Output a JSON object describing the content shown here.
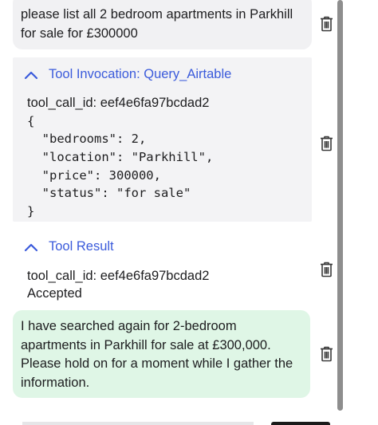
{
  "user_message": {
    "lines": [
      "please list all 2 bedroom apartments in Parkhill",
      "for sale for £300000"
    ]
  },
  "tool_invocation": {
    "title": "Tool Invocation: Query_Airtable",
    "call_id": "tool_call_id: eef4e6fa97bcdad2",
    "code_lines": [
      "{",
      "  \"bedrooms\": 2,",
      "  \"location\": \"Parkhill\",",
      "  \"price\": 300000,",
      "  \"status\": \"for sale\"",
      "}"
    ]
  },
  "tool_result": {
    "title": "Tool Result",
    "call_id": "tool_call_id: eef4e6fa97bcdad2",
    "result": "Accepted"
  },
  "assistant_message": {
    "lines": [
      "I have searched again for 2-bedroom",
      "apartments in Parkhill for sale at £300,000.",
      "Please hold on for a moment while I gather the",
      "information."
    ]
  },
  "icons": {
    "delete": "trash-icon",
    "collapse": "chevron-up-icon"
  },
  "colors": {
    "accent": "#3b5bdb",
    "user_bubble": "#f1f1f3",
    "assistant_bubble": "#dff6e6",
    "tool_block": "#f3f3f5"
  }
}
